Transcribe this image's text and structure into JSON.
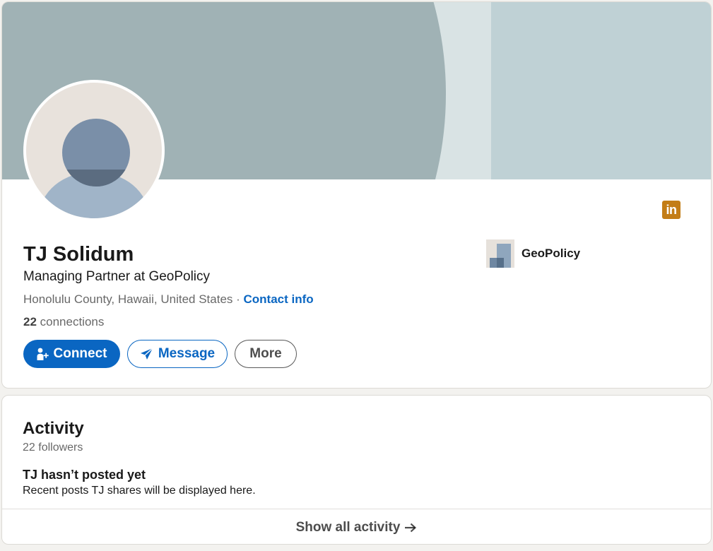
{
  "profile": {
    "name": "TJ Solidum",
    "headline": "Managing Partner at GeoPolicy",
    "location": "Honolulu County, Hawaii, United States",
    "location_separator": " · ",
    "contact_info_label": "Contact info",
    "connections_count": "22",
    "connections_label": " connections",
    "badge_text": "in",
    "actions": {
      "connect_label": "Connect",
      "message_label": "Message",
      "more_label": "More"
    },
    "company": {
      "name": "GeoPolicy"
    }
  },
  "activity": {
    "title": "Activity",
    "followers": "22 followers",
    "empty_title": "TJ hasn’t posted yet",
    "empty_subtitle": "Recent posts TJ shares will be displayed here.",
    "show_all_label": "Show all activity"
  },
  "colors": {
    "accent": "#0a66c2",
    "banner_dark": "#a0b2b5",
    "banner_light": "#bfd1d5",
    "linkedin_badge": "#c37d16"
  },
  "icons": {
    "connect": "person-add-icon",
    "message": "send-icon",
    "show_all": "arrow-right-icon",
    "badge": "linkedin-icon"
  }
}
